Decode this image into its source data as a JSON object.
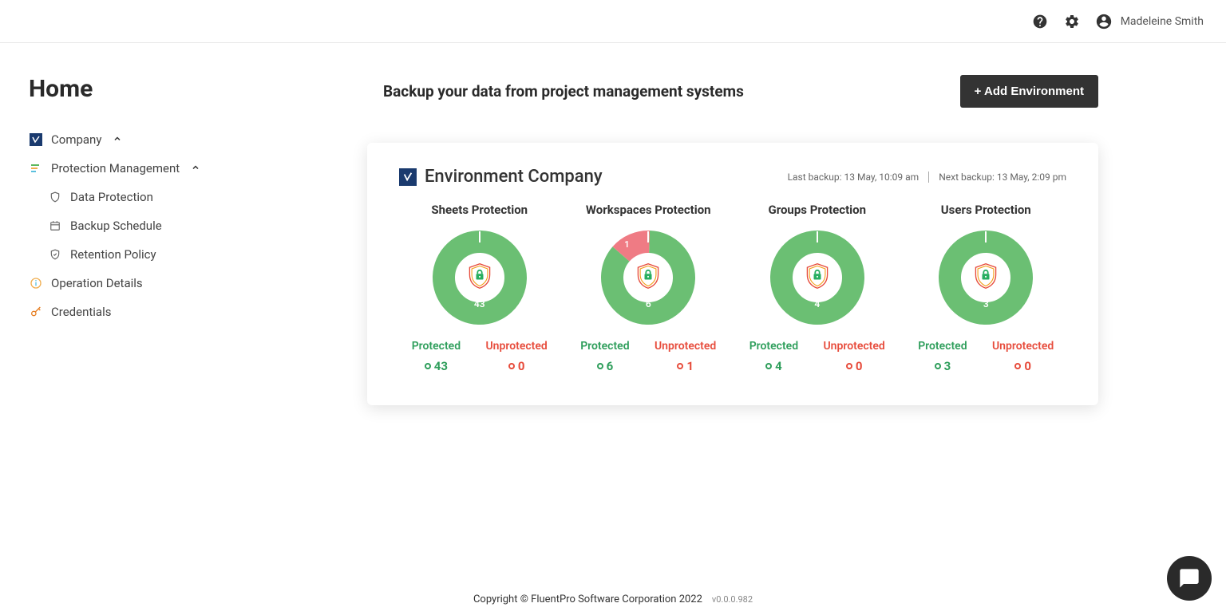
{
  "header": {
    "user_name": "Madeleine Smith"
  },
  "sidebar": {
    "title": "Home",
    "company": "Company",
    "protection_management": "Protection Management",
    "data_protection": "Data Protection",
    "backup_schedule": "Backup Schedule",
    "retention_policy": "Retention Policy",
    "operation_details": "Operation Details",
    "credentials": "Credentials"
  },
  "main": {
    "heading": "Backup your data from project management systems",
    "add_button": "+ Add Environment"
  },
  "card": {
    "env_title": "Environment Company",
    "last_backup": "Last backup: 13 May, 10:09 am",
    "next_backup": "Next backup: 13 May, 2:09 pm",
    "protected_label": "Protected",
    "unprotected_label": "Unprotected",
    "charts": [
      {
        "title": "Sheets Protection",
        "protected": 43,
        "unprotected": 0,
        "total": "43"
      },
      {
        "title": "Workspaces Protection",
        "protected": 6,
        "unprotected": 1,
        "total": "6",
        "unpr_label": "1"
      },
      {
        "title": "Groups Protection",
        "protected": 4,
        "unprotected": 0,
        "total": "4"
      },
      {
        "title": "Users Protection",
        "protected": 3,
        "unprotected": 0,
        "total": "3"
      }
    ]
  },
  "footer": {
    "copyright": "Copyright © FluentPro Software Corporation 2022",
    "version": "v0.0.0.982"
  },
  "chart_data": [
    {
      "type": "pie",
      "title": "Sheets Protection",
      "series": [
        {
          "name": "Protected",
          "value": 43
        },
        {
          "name": "Unprotected",
          "value": 0
        }
      ]
    },
    {
      "type": "pie",
      "title": "Workspaces Protection",
      "series": [
        {
          "name": "Protected",
          "value": 6
        },
        {
          "name": "Unprotected",
          "value": 1
        }
      ]
    },
    {
      "type": "pie",
      "title": "Groups Protection",
      "series": [
        {
          "name": "Protected",
          "value": 4
        },
        {
          "name": "Unprotected",
          "value": 0
        }
      ]
    },
    {
      "type": "pie",
      "title": "Users Protection",
      "series": [
        {
          "name": "Protected",
          "value": 3
        },
        {
          "name": "Unprotected",
          "value": 0
        }
      ]
    }
  ]
}
